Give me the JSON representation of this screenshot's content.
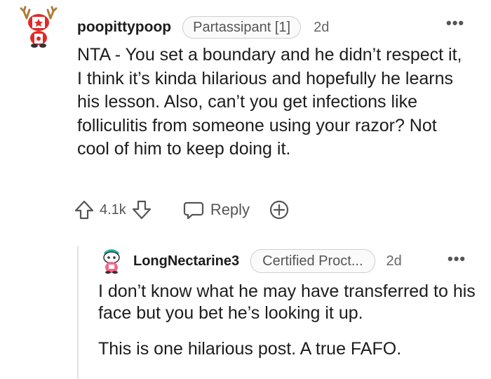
{
  "comment": {
    "username": "poopittypoop",
    "flair": "Partassipant [1]",
    "time": "2d",
    "more_icon": "more-options-icon",
    "body": "NTA - You set a boundary and he didn’t respect it, I think it’s kinda hilarious and hopefully he learns his lesson. Also, can’t you get infections like folliculitis from someone using your razor? Not cool of him to keep doing it.",
    "votes": "4.1k",
    "reply_label": "Reply",
    "icons": {
      "upvote": "upvote-icon",
      "downvote": "downvote-icon",
      "reply": "comment-bubble-icon",
      "award": "award-icon"
    }
  },
  "reply": {
    "username": "LongNectarine3",
    "flair": "Certified Proct...",
    "time": "2d",
    "paragraphs": [
      "I don’t know what he may have transferred to his face but you bet he’s looking it up.",
      "This is one hilarious post. A true FAFO."
    ]
  },
  "colors": {
    "text": "#1c1c1c",
    "muted": "#555555",
    "border": "#cfcfcf"
  }
}
